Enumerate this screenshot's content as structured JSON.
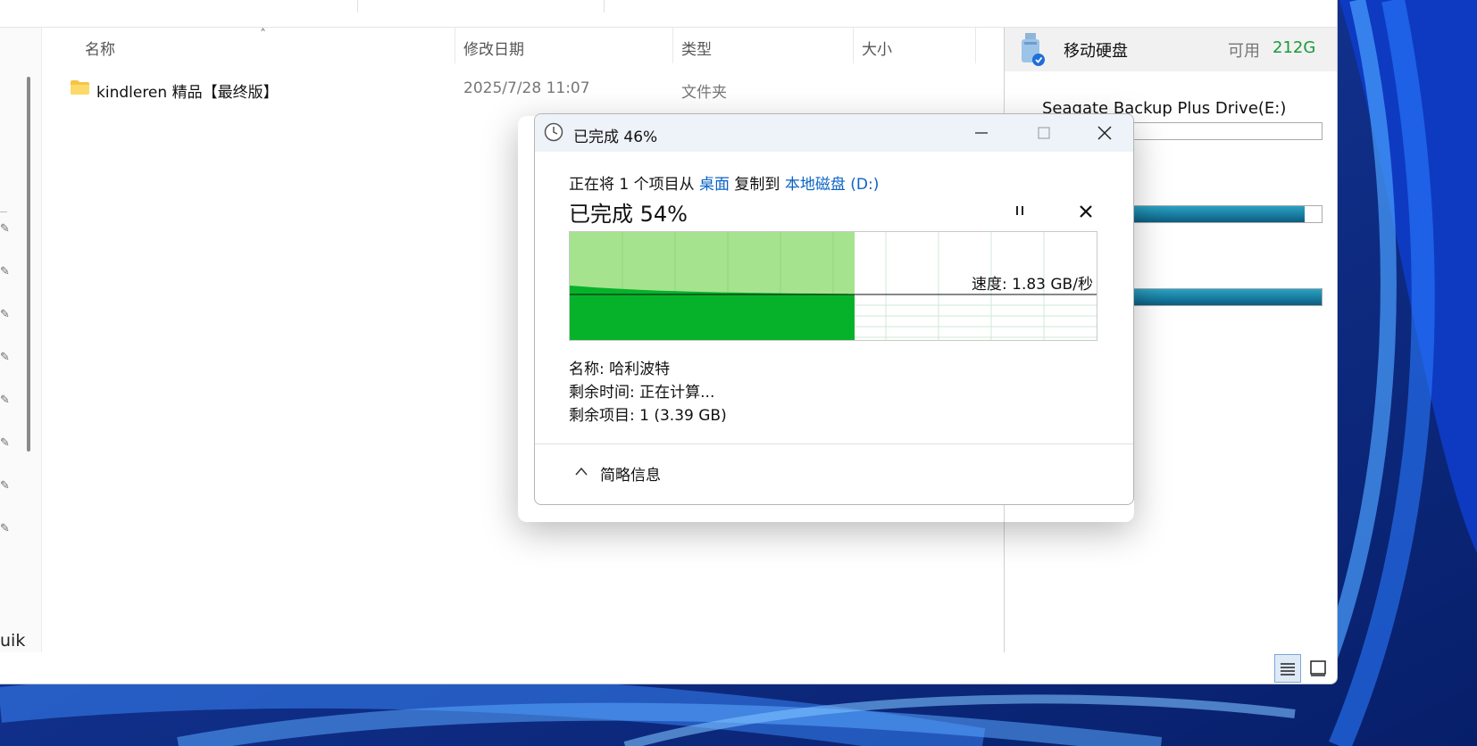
{
  "colors": {
    "accent_link": "#0b63c4",
    "progress_light": "#a6e38e",
    "progress_dark": "#06b22a",
    "free_space": "#1a9a3a"
  },
  "file_list": {
    "columns": [
      "名称",
      "修改日期",
      "类型",
      "大小"
    ],
    "rows": [
      {
        "name": "kindleren 精品【最终版】",
        "modified": "2025/7/28 11:07",
        "type": "文件夹",
        "size": ""
      }
    ]
  },
  "nav": {
    "truncated_text": "uik",
    "pin_icon": "pin-icon"
  },
  "details": {
    "drive_title": "移动硬盘",
    "free_label": "可用",
    "free_value": "212G",
    "drive_name": "Seagate Backup Plus Drive(E:)",
    "usage": [
      0.08,
      0.94,
      1.0
    ]
  },
  "dialog": {
    "title": "已完成 46%",
    "line1_prefix": "正在将 1 个项目从 ",
    "source": "桌面",
    "line1_mid": " 复制到 ",
    "dest": "本地磁盘 (D:)",
    "percent_label": "已完成 54%",
    "progress_fraction": 0.54,
    "speed": "速度: 1.83 GB/秒",
    "name_line": "名称: 哈利波特",
    "remaining_time": "剩余时间: 正在计算...",
    "remaining_items": "剩余项目: 1 (3.39 GB)",
    "less_details": "简略信息"
  }
}
